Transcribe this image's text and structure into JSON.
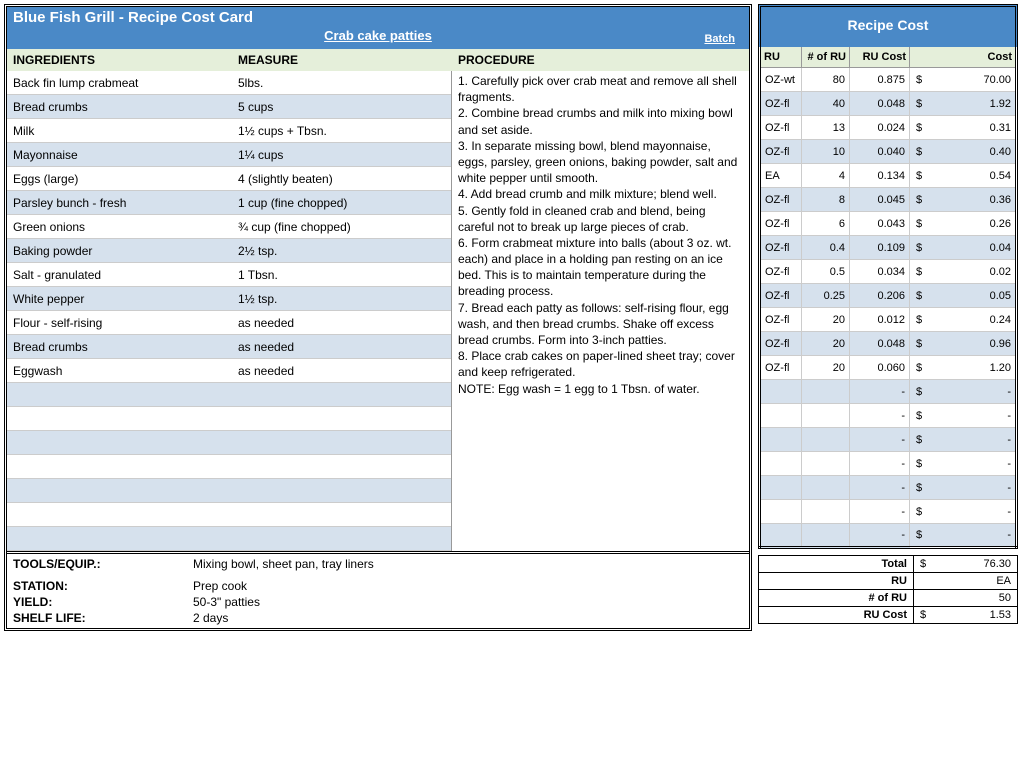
{
  "header": {
    "title": "Blue Fish Grill - Recipe Cost Card",
    "subtitle": "Crab cake patties",
    "batch_label": "Batch"
  },
  "columns": {
    "ingredients": "INGREDIENTS",
    "measure": "MEASURE",
    "procedure": "PROCEDURE"
  },
  "ingredients": [
    {
      "name": "Back fin lump crabmeat",
      "measure": "5lbs."
    },
    {
      "name": "Bread crumbs",
      "measure": "5 cups"
    },
    {
      "name": "Milk",
      "measure": "1½ cups + Tbsn."
    },
    {
      "name": "Mayonnaise",
      "measure": "1¼ cups"
    },
    {
      "name": "Eggs (large)",
      "measure": "4 (slightly beaten)"
    },
    {
      "name": "Parsley bunch - fresh",
      "measure": "1 cup (fine chopped)"
    },
    {
      "name": "Green onions",
      "measure": "¾ cup (fine chopped)"
    },
    {
      "name": "Baking powder",
      "measure": "2½ tsp."
    },
    {
      "name": "Salt - granulated",
      "measure": "1 Tbsn."
    },
    {
      "name": "White pepper",
      "measure": "1½ tsp."
    },
    {
      "name": "Flour - self-rising",
      "measure": "as needed"
    },
    {
      "name": "Bread crumbs",
      "measure": "as needed"
    },
    {
      "name": "Eggwash",
      "measure": "as needed"
    },
    {
      "name": "",
      "measure": ""
    },
    {
      "name": "",
      "measure": ""
    },
    {
      "name": "",
      "measure": ""
    },
    {
      "name": "",
      "measure": ""
    },
    {
      "name": "",
      "measure": ""
    },
    {
      "name": "",
      "measure": ""
    },
    {
      "name": "",
      "measure": ""
    }
  ],
  "procedure": [
    "1. Carefully pick over crab meat and remove all shell fragments.",
    "2. Combine bread crumbs and milk into mixing bowl and set aside.",
    "3. In separate missing bowl, blend mayonnaise, eggs, parsley, green onions, baking powder, salt and white pepper until smooth.",
    "4. Add bread crumb and milk mixture; blend well.",
    "5. Gently fold in cleaned crab and blend, being careful not to break up large pieces of crab.",
    "6. Form crabmeat mixture into balls (about 3 oz. wt. each) and place in a holding pan resting on an ice bed. This is to maintain temperature during the breading process.",
    "7. Bread each patty as follows: self-rising flour, egg wash, and then bread crumbs. Shake off excess bread crumbs. Form into 3-inch patties.",
    "8. Place crab cakes on paper-lined sheet tray; cover and keep refrigerated.",
    "NOTE: Egg wash = 1 egg to 1 Tbsn. of water."
  ],
  "footer": {
    "tools_label": "TOOLS/EQUIP.:",
    "tools": "Mixing bowl, sheet pan, tray liners",
    "station_label": "STATION:",
    "station": "Prep cook",
    "yield_label": "YIELD:",
    "yield": "50-3\" patties",
    "shelf_label": "SHELF LIFE:",
    "shelf": "2 days"
  },
  "recipe_cost": {
    "title": "Recipe Cost",
    "headers": {
      "ru": "RU",
      "num": "# of RU",
      "rucost": "RU Cost",
      "cost": "Cost"
    },
    "rows": [
      {
        "ru": "OZ-wt",
        "num": "80",
        "rucost": "0.875",
        "cost": "70.00"
      },
      {
        "ru": "OZ-fl",
        "num": "40",
        "rucost": "0.048",
        "cost": "1.92"
      },
      {
        "ru": "OZ-fl",
        "num": "13",
        "rucost": "0.024",
        "cost": "0.31"
      },
      {
        "ru": "OZ-fl",
        "num": "10",
        "rucost": "0.040",
        "cost": "0.40"
      },
      {
        "ru": "EA",
        "num": "4",
        "rucost": "0.134",
        "cost": "0.54"
      },
      {
        "ru": "OZ-fl",
        "num": "8",
        "rucost": "0.045",
        "cost": "0.36"
      },
      {
        "ru": "OZ-fl",
        "num": "6",
        "rucost": "0.043",
        "cost": "0.26"
      },
      {
        "ru": "OZ-fl",
        "num": "0.4",
        "rucost": "0.109",
        "cost": "0.04"
      },
      {
        "ru": "OZ-fl",
        "num": "0.5",
        "rucost": "0.034",
        "cost": "0.02"
      },
      {
        "ru": "OZ-fl",
        "num": "0.25",
        "rucost": "0.206",
        "cost": "0.05"
      },
      {
        "ru": "OZ-fl",
        "num": "20",
        "rucost": "0.012",
        "cost": "0.24"
      },
      {
        "ru": "OZ-fl",
        "num": "20",
        "rucost": "0.048",
        "cost": "0.96"
      },
      {
        "ru": "OZ-fl",
        "num": "20",
        "rucost": "0.060",
        "cost": "1.20"
      },
      {
        "ru": "",
        "num": "",
        "rucost": "-",
        "cost": "-"
      },
      {
        "ru": "",
        "num": "",
        "rucost": "-",
        "cost": "-"
      },
      {
        "ru": "",
        "num": "",
        "rucost": "-",
        "cost": "-"
      },
      {
        "ru": "",
        "num": "",
        "rucost": "-",
        "cost": "-"
      },
      {
        "ru": "",
        "num": "",
        "rucost": "-",
        "cost": "-"
      },
      {
        "ru": "",
        "num": "",
        "rucost": "-",
        "cost": "-"
      },
      {
        "ru": "",
        "num": "",
        "rucost": "-",
        "cost": "-"
      }
    ],
    "totals": {
      "total_label": "Total",
      "total": "76.30",
      "ru_label": "RU",
      "ru": "EA",
      "numru_label": "# of RU",
      "numru": "50",
      "rucost_label": "RU Cost",
      "rucost": "1.53"
    }
  }
}
